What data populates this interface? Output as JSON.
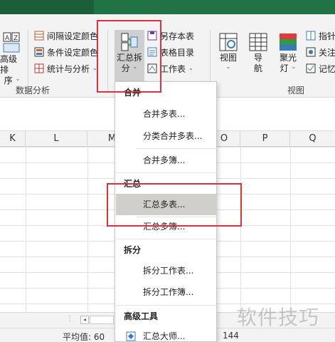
{
  "ribbon": {
    "left_group": {
      "sort_button_line1": "高级排",
      "sort_button_line2": "序",
      "caret": "⌄",
      "items": [
        "间隔设定颜色",
        "条件设定颜色",
        "统计与分析"
      ],
      "item3_caret": "⌄",
      "label": "数据分析"
    },
    "summary_split": {
      "line1": "汇总拆",
      "line2": "分",
      "caret": "⌄"
    },
    "mid_items": [
      "另存本表",
      "表格目录",
      "工作表"
    ],
    "mid_item3_caret": "⌄",
    "view_group": {
      "view_button": {
        "line1": "视图",
        "caret": "⌄"
      },
      "nav_button": {
        "line1": "导",
        "line2": "航"
      },
      "spotlight_button": {
        "line1": "聚光",
        "line2": "灯",
        "caret": "⌄"
      },
      "right_items": [
        "指针",
        "关注",
        "记忆"
      ],
      "label": "视图"
    }
  },
  "columns": [
    "K",
    "L",
    "M",
    "O",
    "P",
    "Q"
  ],
  "status": {
    "average": "平均值: 60",
    "partial_count": "144"
  },
  "menu": {
    "sections": [
      {
        "header": "合并",
        "items": [
          "合并多表...",
          "分类合并多表...",
          "合并多簿..."
        ]
      },
      {
        "header": "汇总",
        "items": [
          "汇总多表...",
          "汇总多簿..."
        ]
      },
      {
        "header": "拆分",
        "items": [
          "拆分工作表...",
          "拆分工作簿..."
        ]
      },
      {
        "header": "高级工具",
        "items": [
          "汇总大师..."
        ]
      }
    ],
    "highlighted_item": "汇总多表..."
  },
  "watermark": "软件技巧",
  "colors": {
    "accent_green": "#217346",
    "highlight_box": "#e0313a",
    "menu_hover": "#d0cfcc"
  },
  "icons": [
    "sort-icon",
    "interval-color-icon",
    "condition-color-icon",
    "stats-icon",
    "summary-split-icon",
    "save-sheet-icon",
    "table-directory-icon",
    "worksheet-icon",
    "view-icon",
    "navigation-icon",
    "spotlight-icon",
    "pointer-icon",
    "focus-icon",
    "memory-icon",
    "summary-master-icon"
  ]
}
